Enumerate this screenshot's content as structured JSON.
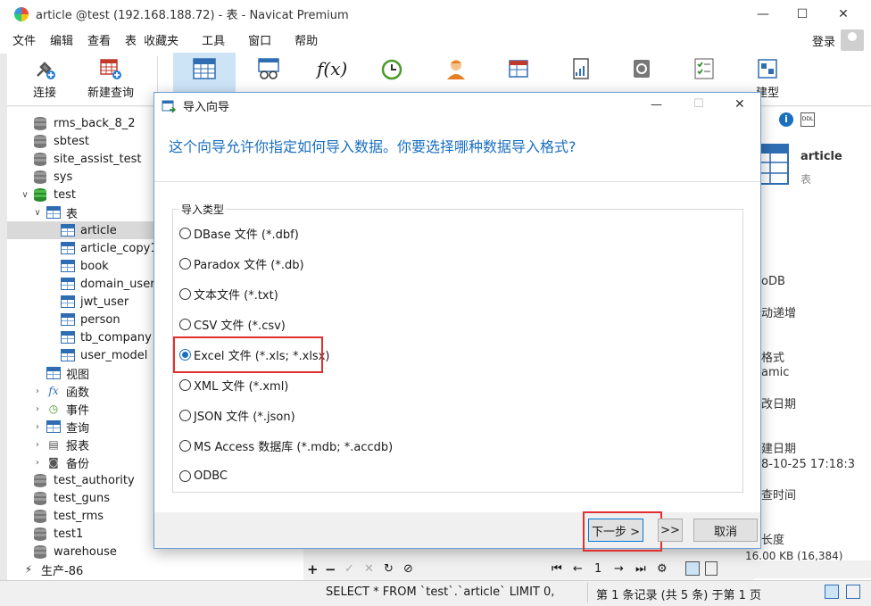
{
  "window": {
    "title": "article @test (192.168.188.72) - 表 - Navicat Premium",
    "minimize": "—",
    "maximize": "☐",
    "close": "✕"
  },
  "menubar": {
    "items": [
      "文件",
      "编辑",
      "查看",
      "表",
      "收藏夹",
      "工具",
      "窗口",
      "帮助"
    ],
    "login": "登录"
  },
  "toolbar": {
    "connect_label": "连接",
    "new_query_label": "新建查询",
    "partial_label": "建型"
  },
  "sidebar": {
    "items": [
      {
        "label": "rms_back_8_2",
        "type": "db"
      },
      {
        "label": "sbtest",
        "type": "db"
      },
      {
        "label": "site_assist_test",
        "type": "db"
      },
      {
        "label": "sys",
        "type": "db"
      },
      {
        "label": "test",
        "type": "db-open"
      },
      {
        "label": "表",
        "type": "tables-folder"
      },
      {
        "label": "article",
        "type": "table"
      },
      {
        "label": "article_copy1",
        "type": "table"
      },
      {
        "label": "book",
        "type": "table"
      },
      {
        "label": "domain_user",
        "type": "table"
      },
      {
        "label": "jwt_user",
        "type": "table"
      },
      {
        "label": "person",
        "type": "table"
      },
      {
        "label": "tb_company",
        "type": "table"
      },
      {
        "label": "user_model",
        "type": "table"
      },
      {
        "label": "视图",
        "type": "folder"
      },
      {
        "label": "函数",
        "type": "folder"
      },
      {
        "label": "事件",
        "type": "folder"
      },
      {
        "label": "查询",
        "type": "folder"
      },
      {
        "label": "报表",
        "type": "folder"
      },
      {
        "label": "备份",
        "type": "folder"
      },
      {
        "label": "test_authority",
        "type": "db"
      },
      {
        "label": "test_guns",
        "type": "db"
      },
      {
        "label": "test_rms",
        "type": "db"
      },
      {
        "label": "test1",
        "type": "db"
      },
      {
        "label": "warehouse",
        "type": "db"
      },
      {
        "label": "生产-86",
        "type": "conn"
      }
    ]
  },
  "rightpanel": {
    "table_name": "article",
    "table_type": "表",
    "engine_partial": "oDB",
    "auto_partial": "动递增",
    "format_label_partial": "格式",
    "format_value_partial": "amic",
    "modified_label_partial": "改日期",
    "created_label_partial": "建日期",
    "created_value_partial": "8-10-25 17:18:3",
    "check_time_partial": "查时间",
    "length_partial": "长度",
    "size_partial": "16.00 KB (16,384)"
  },
  "dialog": {
    "title": "导入向导",
    "prompt": "这个向导允许你指定如何导入数据。你要选择哪种数据导入格式?",
    "group_label": "导入类型",
    "options": [
      {
        "label": "DBase 文件 (*.dbf)",
        "selected": false
      },
      {
        "label": "Paradox 文件 (*.db)",
        "selected": false
      },
      {
        "label": "文本文件 (*.txt)",
        "selected": false
      },
      {
        "label": "CSV 文件 (*.csv)",
        "selected": false
      },
      {
        "label": "Excel 文件 (*.xls; *.xlsx)",
        "selected": true
      },
      {
        "label": "XML 文件 (*.xml)",
        "selected": false
      },
      {
        "label": "JSON 文件 (*.json)",
        "selected": false
      },
      {
        "label": "MS Access 数据库 (*.mdb; *.accdb)",
        "selected": false
      },
      {
        "label": "ODBC",
        "selected": false
      }
    ],
    "next_label": "下一步 >",
    "skip_label": ">>",
    "cancel_label": "取消"
  },
  "navbar": {
    "page": "1"
  },
  "statusbar": {
    "sql": "SELECT * FROM `test`.`article` LIMIT 0,",
    "records": "第 1 条记录 (共 5 条) 于第 1 页"
  },
  "colors": {
    "accent": "#1a6fc0",
    "highlight": "#e03030",
    "selected_row": "#d9d9d9"
  }
}
